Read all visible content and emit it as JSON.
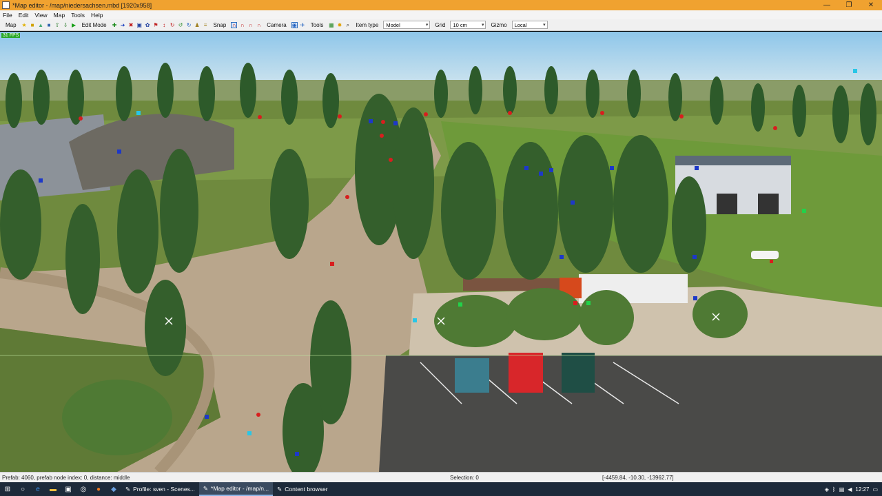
{
  "window": {
    "title": "*Map editor - /map/niedersachsen.mbd [1920x958]",
    "minimize": "—",
    "restore": "❐",
    "close": "✕"
  },
  "menu": [
    "File",
    "Edit",
    "View",
    "Map",
    "Tools",
    "Help"
  ],
  "toolbar": {
    "map_label": "Map",
    "edit_mode_label": "Edit Mode",
    "snap_label": "Snap",
    "camera_label": "Camera",
    "tools_label": "Tools",
    "item_type_label": "Item type",
    "item_type_value": "Model",
    "grid_label": "Grid",
    "grid_value": "10 cm",
    "gizmo_label": "Gizmo",
    "gizmo_value": "Local"
  },
  "viewport": {
    "fps": "31 FPS"
  },
  "status": {
    "prefab_info": "Prefab: 4060, prefab node index: 0, distance: middle",
    "selection": "Selection: 0",
    "coordinates": "[-4459.84, -10.30, -13962.77]"
  },
  "taskbar": {
    "apps": [
      {
        "label": "Profile: sven - Scenes..."
      },
      {
        "label": "*Map editor - /map/n..."
      },
      {
        "label": "Content browser"
      }
    ],
    "clock": "12:27"
  },
  "colors": {
    "titlebar": "#f0a230",
    "taskbar": "#1d2a3a",
    "fps_badge": "#29a829"
  }
}
